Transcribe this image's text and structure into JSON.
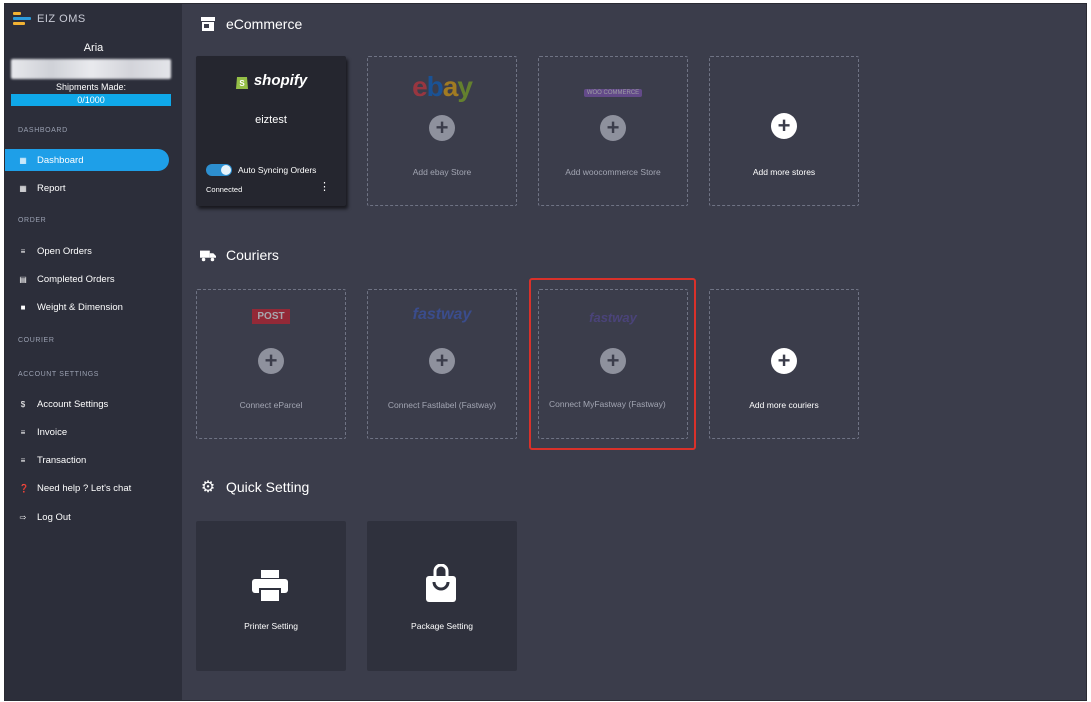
{
  "brand": {
    "name": "EIZ OMS"
  },
  "user": {
    "name": "Aria",
    "shipments_label": "Shipments Made:",
    "shipments_value": "0/1000"
  },
  "sidebar": {
    "sections": {
      "dashboard": "DASHBOARD",
      "order": "ORDER",
      "courier": "COURIER",
      "account": "ACCOUNT SETTINGS"
    },
    "items": [
      {
        "label": "Dashboard",
        "icon": "grid-icon",
        "active": true
      },
      {
        "label": "Report",
        "icon": "grid-icon"
      },
      {
        "label": "Open Orders",
        "icon": "list-icon"
      },
      {
        "label": "Completed Orders",
        "icon": "box-icon"
      },
      {
        "label": "Weight & Dimension",
        "icon": "square-icon"
      },
      {
        "label": "Account Settings",
        "icon": "dollar-icon"
      },
      {
        "label": "Invoice",
        "icon": "list-icon"
      },
      {
        "label": "Transaction",
        "icon": "list-icon"
      },
      {
        "label": "Need help ? Let's chat",
        "icon": "question-icon"
      },
      {
        "label": "Log Out",
        "icon": "logout-icon"
      }
    ]
  },
  "ecommerce": {
    "title": "eCommerce",
    "shopify": {
      "logo": "shopify",
      "store": "eiztest",
      "sync_label": "Auto Syncing Orders",
      "status": "Connected"
    },
    "cards": [
      {
        "logo": "ebay",
        "label": "Add ebay Store"
      },
      {
        "logo": "WOO COMMERCE",
        "label": "Add woocommerce Store"
      },
      {
        "label": "Add more stores"
      }
    ]
  },
  "couriers": {
    "title": "Couriers",
    "cards": [
      {
        "logo": "POST",
        "label": "Connect eParcel"
      },
      {
        "logo": "fastway",
        "label": "Connect Fastlabel (Fastway)"
      },
      {
        "logo": "fastway",
        "label": "Connect MyFastway (Fastway)"
      },
      {
        "label": "Add more couriers"
      }
    ]
  },
  "quick": {
    "title": "Quick Setting",
    "cards": [
      {
        "label": "Printer Setting",
        "icon": "printer-icon"
      },
      {
        "label": "Package Setting",
        "icon": "bag-icon"
      }
    ]
  },
  "colors": {
    "accent": "#1e9fe8",
    "highlight": "#d9312a",
    "bg": "#3b3d4b",
    "sidebar": "#2c2e3a"
  }
}
